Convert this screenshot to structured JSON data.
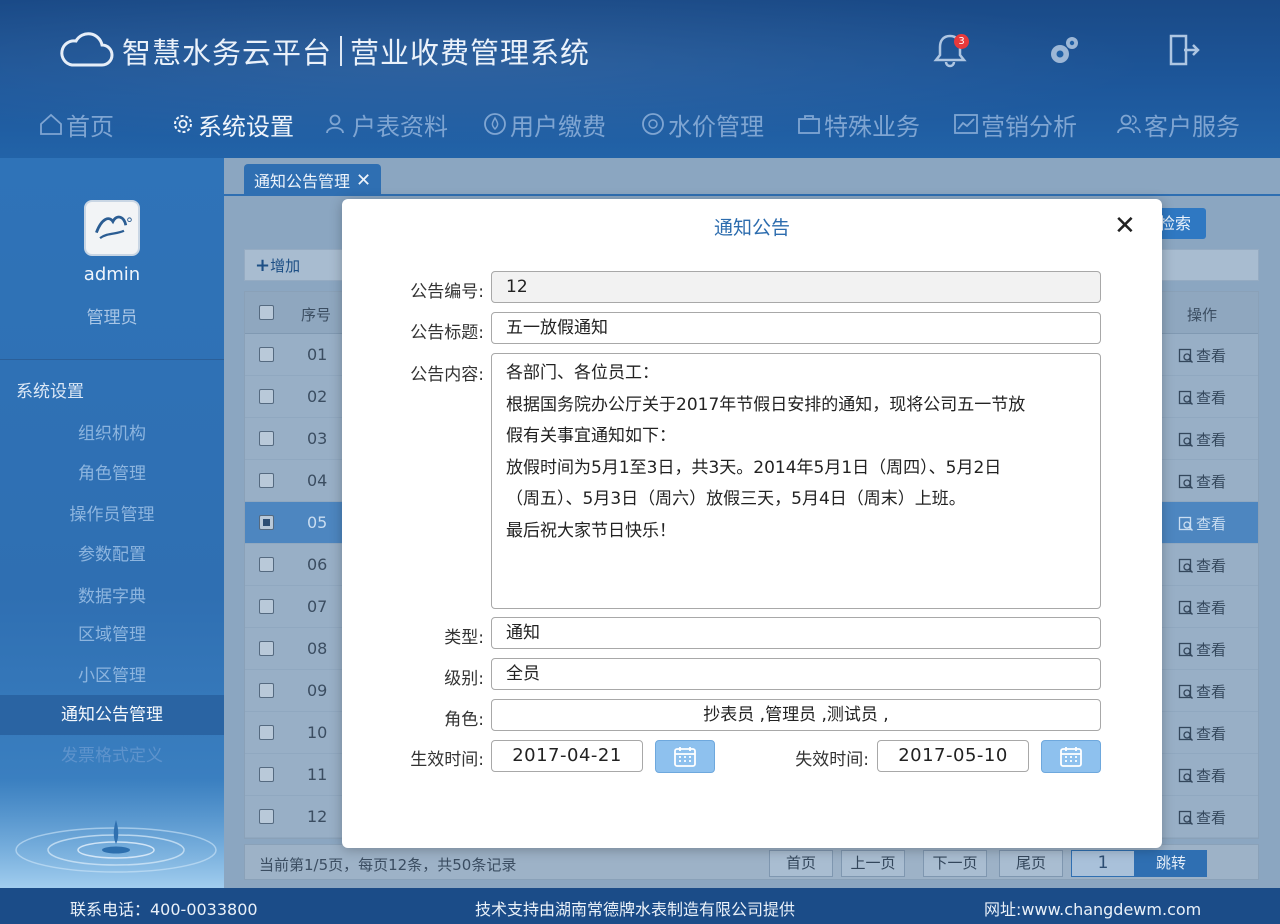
{
  "header": {
    "brand": "智慧水务云平台",
    "system": "营业收费管理系统",
    "notification_count": "3"
  },
  "nav": [
    {
      "label": "首页",
      "icon": "home-icon"
    },
    {
      "label": "系统设置",
      "icon": "gear-icon"
    },
    {
      "label": "户表资料",
      "icon": "user-icon"
    },
    {
      "label": "用户缴费",
      "icon": "drop-icon"
    },
    {
      "label": "水价管理",
      "icon": "coin-icon"
    },
    {
      "label": "特殊业务",
      "icon": "briefcase-icon"
    },
    {
      "label": "营销分析",
      "icon": "chart-icon"
    },
    {
      "label": "客户服务",
      "icon": "users-icon"
    }
  ],
  "sidebar": {
    "username": "admin",
    "role": "管理员",
    "section": "系统设置",
    "items": [
      {
        "label": "组织机构"
      },
      {
        "label": "角色管理"
      },
      {
        "label": "操作员管理"
      },
      {
        "label": "参数配置"
      },
      {
        "label": "数据字典"
      },
      {
        "label": "区域管理"
      },
      {
        "label": "小区管理"
      },
      {
        "label": "通知公告管理"
      },
      {
        "label": "发票格式定义"
      }
    ]
  },
  "tab": {
    "label": "通知公告管理",
    "close": "✕"
  },
  "toolbar": {
    "search_label": "检索",
    "add_label": "增加"
  },
  "table": {
    "headers": {
      "seq": "序号",
      "action": "操作"
    },
    "rows": [
      {
        "seq": "01",
        "action": "查看"
      },
      {
        "seq": "02",
        "action": "查看"
      },
      {
        "seq": "03",
        "action": "查看"
      },
      {
        "seq": "04",
        "action": "查看"
      },
      {
        "seq": "05",
        "action": "查看"
      },
      {
        "seq": "06",
        "action": "查看"
      },
      {
        "seq": "07",
        "action": "查看"
      },
      {
        "seq": "08",
        "action": "查看"
      },
      {
        "seq": "09",
        "action": "查看"
      },
      {
        "seq": "10",
        "action": "查看"
      },
      {
        "seq": "11",
        "action": "查看"
      },
      {
        "seq": "12",
        "action": "查看"
      }
    ]
  },
  "pager": {
    "info": "当前第1/5页，每页12条，共50条记录",
    "first": "首页",
    "prev": "上一页",
    "next": "下一页",
    "last": "尾页",
    "page_value": "1",
    "go": "跳转"
  },
  "footer": {
    "phone": "联系电话：400-0033800",
    "support": "技术支持由湖南常德牌水表制造有限公司提供",
    "site": "网址:www.changdewm.com"
  },
  "modal": {
    "title": "通知公告",
    "close": "✕",
    "fields": {
      "id_label": "公告编号:",
      "id_value": "12",
      "title_label": "公告标题:",
      "title_value": "五一放假通知",
      "content_label": "公告内容:",
      "content_lines": [
        "各部门、各位员工：",
        "根据国务院办公厅关于2017年节假日安排的通知，现将公司五一节放",
        "假有关事宜通知如下：",
        "放假时间为5月1至3日，共3天。2014年5月1日（周四）、5月2日",
        "（周五）、5月3日（周六）放假三天，5月4日（周末）上班。",
        "最后祝大家节日快乐！"
      ],
      "type_label": "类型:",
      "type_value": "通知",
      "level_label": "级别:",
      "level_value": "全员",
      "role_label": "角色:",
      "role_value": "抄表员 ,管理员 ,测试员 ,",
      "start_label": "生效时间:",
      "start_value": "2017-04-21",
      "end_label": "失效时间:",
      "end_value": "2017-05-10"
    }
  },
  "colors": {
    "primary": "#2f6fb2",
    "header": "#1d579b",
    "modal_title": "#2c6cae",
    "calendar_button": "#8ec1ee",
    "badge": "#e8393b"
  }
}
